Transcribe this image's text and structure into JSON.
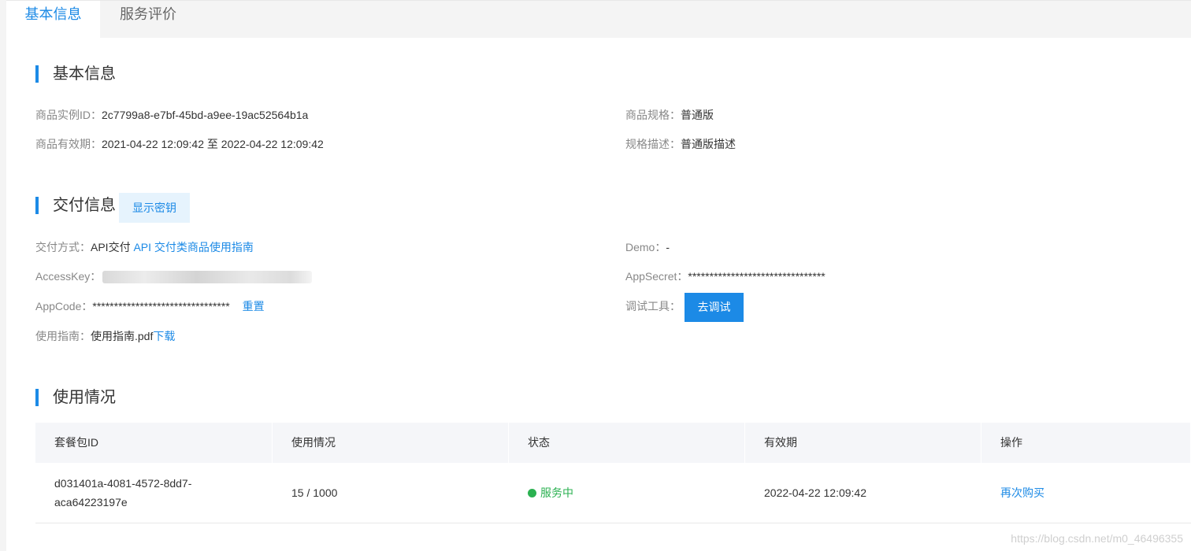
{
  "tabs": {
    "basic": "基本信息",
    "review": "服务评价"
  },
  "sections": {
    "basic_title": "基本信息",
    "delivery_title": "交付信息",
    "usage_title": "使用情况"
  },
  "basic": {
    "instance_id_label": "商品实例ID：",
    "instance_id_value": "2c7799a8-e7bf-45bd-a9ee-19ac52564b1a",
    "validity_label": "商品有效期：",
    "validity_value": "2021-04-22 12:09:42 至 2022-04-22 12:09:42",
    "spec_label": "商品规格：",
    "spec_value": "普通版",
    "spec_desc_label": "规格描述：",
    "spec_desc_value": "普通版描述"
  },
  "delivery": {
    "show_secret_button": "显示密钥",
    "method_label": "交付方式：",
    "method_value": "API交付",
    "method_link": "API 交付类商品使用指南",
    "demo_label": "Demo：",
    "demo_value": "-",
    "accesskey_label": "AccessKey：",
    "appsecret_label": "AppSecret：",
    "appsecret_value": "********************************",
    "appcode_label": "AppCode：",
    "appcode_value": "********************************",
    "reset_link": "重置",
    "debug_label": "调试工具：",
    "debug_button": "去调试",
    "guide_label": "使用指南：",
    "guide_file": "使用指南.pdf",
    "guide_download": "下载"
  },
  "usage_table": {
    "headers": [
      "套餐包ID",
      "使用情况",
      "状态",
      "有效期",
      "操作"
    ],
    "rows": [
      {
        "id_line1": "d031401a-4081-4572-8dd7-",
        "id_line2": "aca64223197e",
        "usage": "15 / 1000",
        "status": "服务中",
        "expiry": "2022-04-22 12:09:42",
        "action": "再次购买"
      }
    ]
  },
  "watermark": "https://blog.csdn.net/m0_46496355",
  "colors": {
    "accent": "#1c8ae6",
    "status_ok": "#2bb151"
  }
}
